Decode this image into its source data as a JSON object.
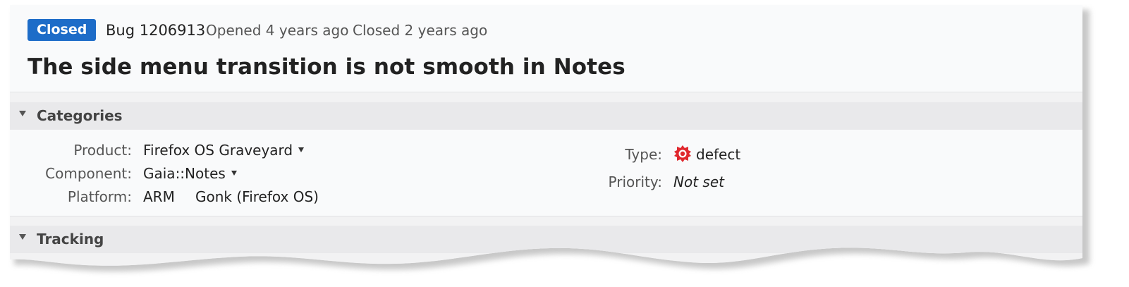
{
  "header": {
    "status": "Closed",
    "bug_id": "Bug 1206913",
    "opened": "Opened 4 years ago",
    "closed": "Closed 2 years ago",
    "title": "The side menu transition is not smooth in Notes"
  },
  "categories": {
    "section_label": "Categories",
    "product_label": "Product:",
    "product_value": "Firefox OS Graveyard",
    "component_label": "Component:",
    "component_value": "Gaia::Notes",
    "platform_label": "Platform:",
    "platform_hw": "ARM",
    "platform_os": "Gonk (Firefox OS)",
    "type_label": "Type:",
    "type_value": "defect",
    "type_icon": "bug-defect-icon",
    "priority_label": "Priority:",
    "priority_value": "Not set"
  },
  "tracking": {
    "section_label": "Tracking"
  },
  "colors": {
    "status_badge": "#1d6cc8",
    "defect_icon": "#e0282e"
  }
}
